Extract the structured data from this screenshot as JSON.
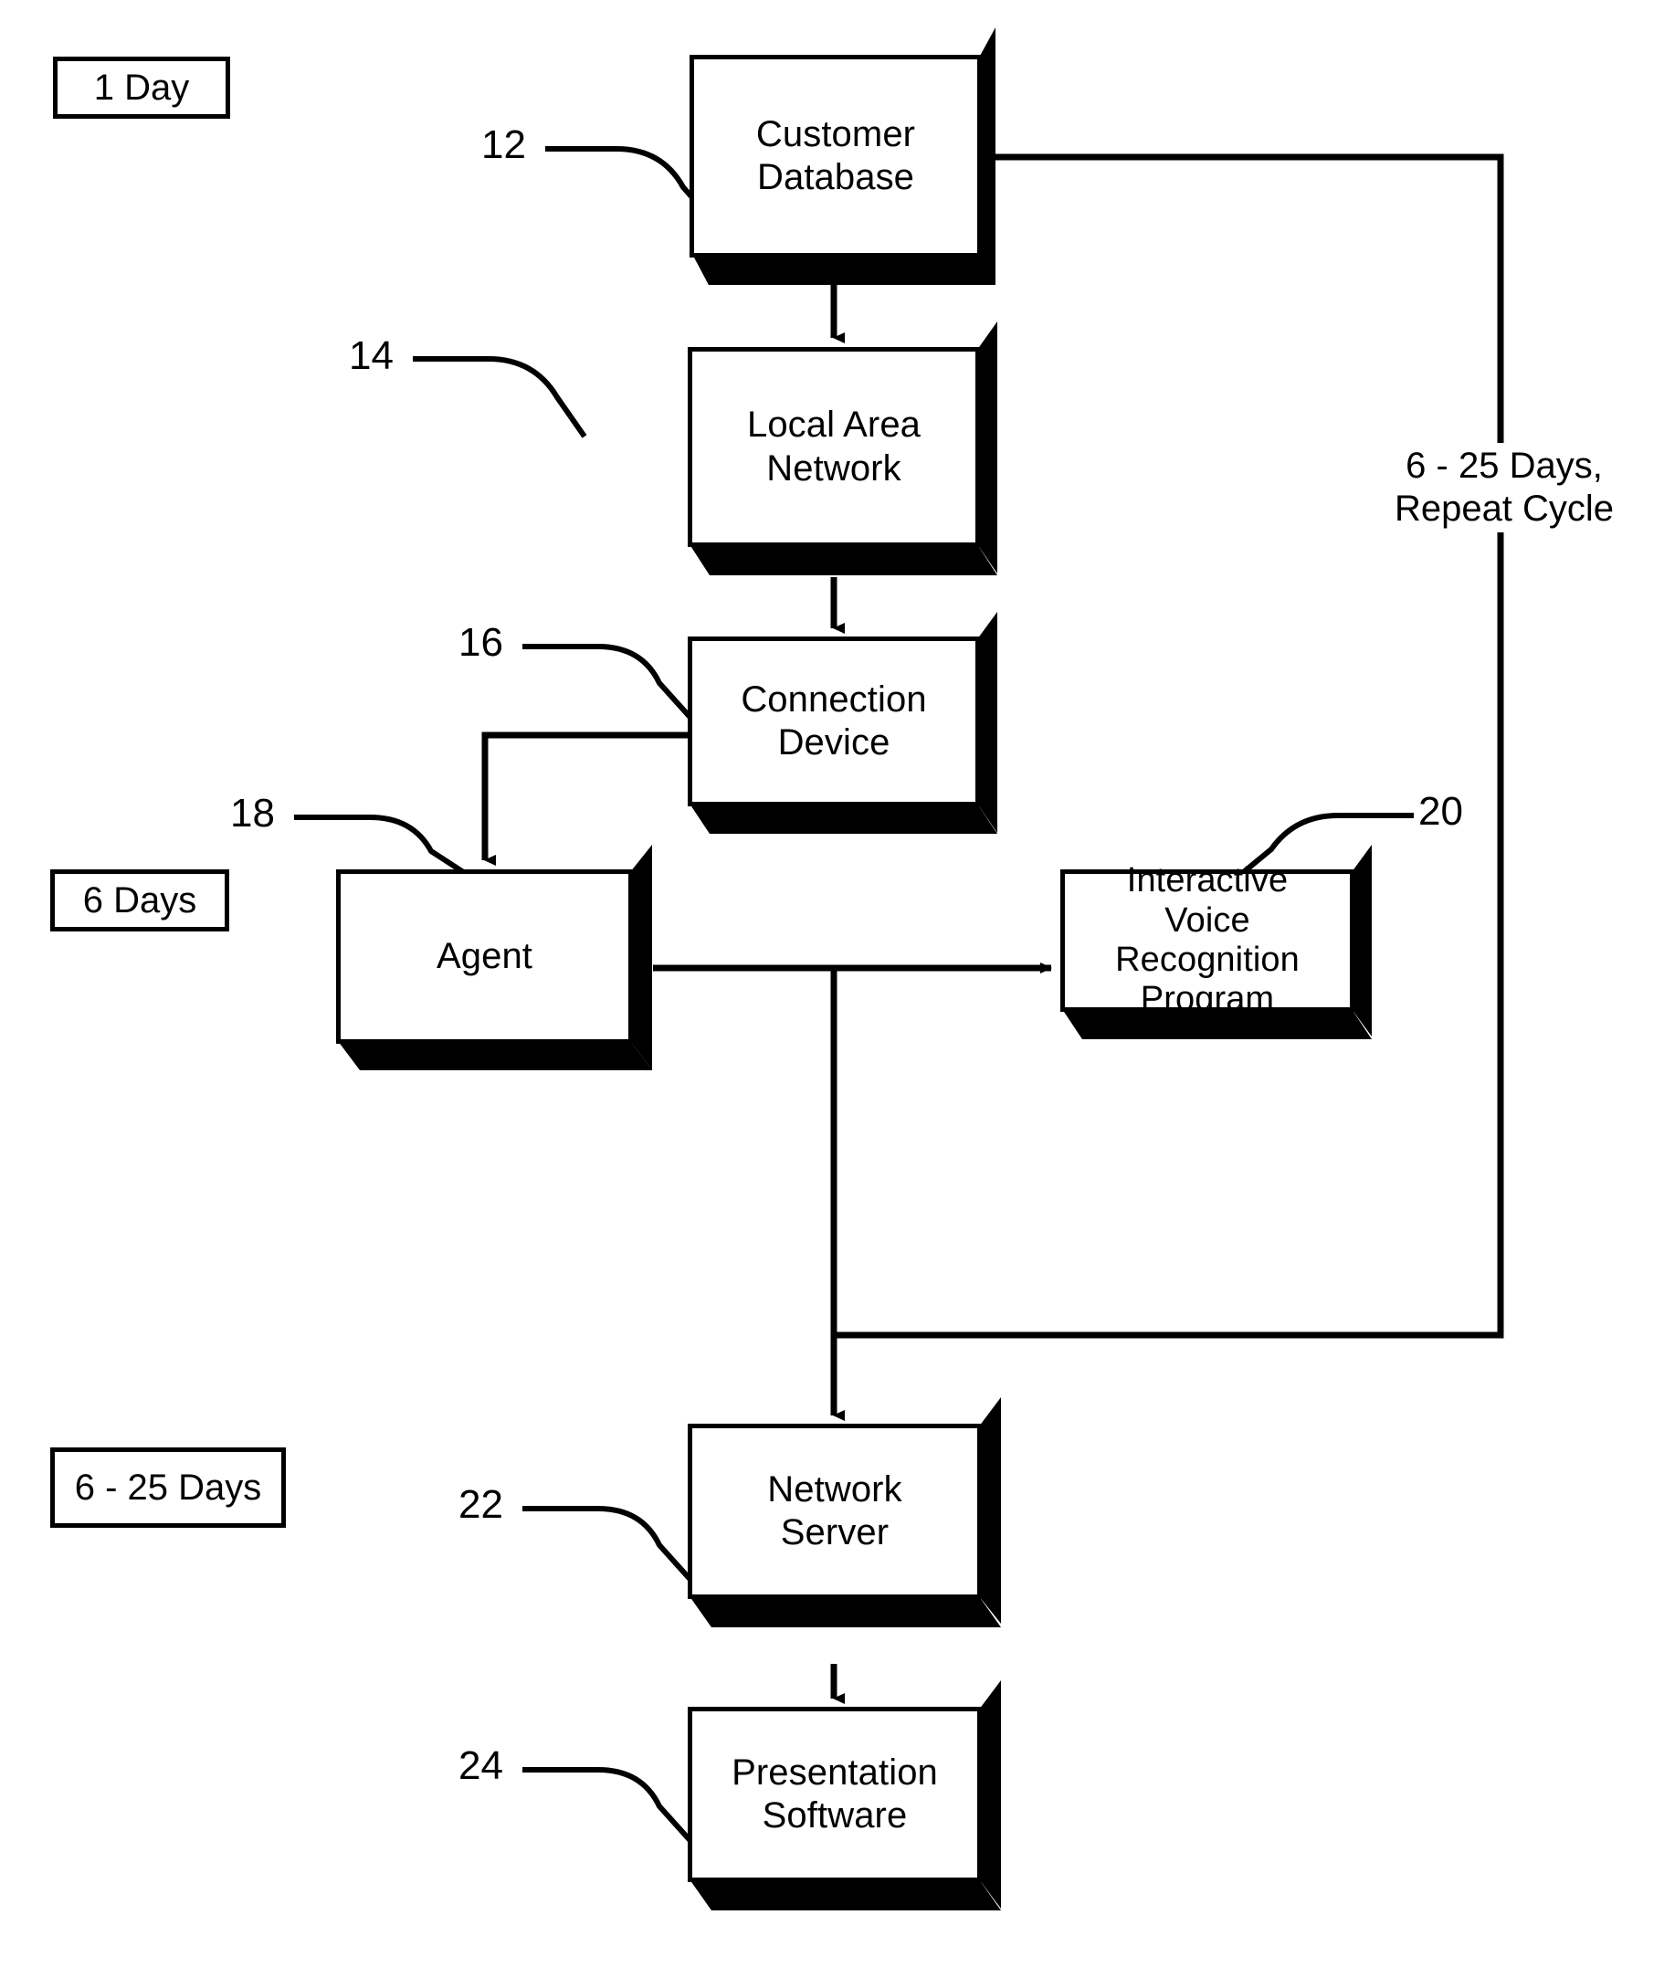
{
  "diagram": {
    "type": "patent-flowchart",
    "figure_style": "3D shadowed block diagram",
    "stroke_color": "#000000",
    "fill_color": "#ffffff",
    "phase_labels": [
      {
        "id": "phase-1-day",
        "text": "1 Day"
      },
      {
        "id": "phase-6-days",
        "text": "6 Days"
      },
      {
        "id": "phase-6-25-days",
        "text": "6 - 25 Days"
      }
    ],
    "nodes": [
      {
        "id": "customer-database",
        "ref": "12",
        "label": "Customer\nDatabase"
      },
      {
        "id": "local-area-network",
        "ref": "14",
        "label": "Local Area\nNetwork"
      },
      {
        "id": "connection-device",
        "ref": "16",
        "label": "Connection\nDevice"
      },
      {
        "id": "agent",
        "ref": "18",
        "label": "Agent"
      },
      {
        "id": "ivr-program",
        "ref": "20",
        "label": "Interactive\nVoice\nRecognition\nProgram"
      },
      {
        "id": "network-server",
        "ref": "22",
        "label": "Network\nServer"
      },
      {
        "id": "presentation-software",
        "ref": "24",
        "label": "Presentation\nSoftware"
      }
    ],
    "annotations": [
      {
        "id": "repeat-cycle-note",
        "text": "6 - 25 Days,\nRepeat Cycle"
      }
    ],
    "connections": [
      {
        "from": "customer-database",
        "to": "local-area-network",
        "kind": "arrow-down"
      },
      {
        "from": "local-area-network",
        "to": "connection-device",
        "kind": "arrow-down"
      },
      {
        "from": "connection-device",
        "to": "agent",
        "kind": "elbow-arrow-down"
      },
      {
        "from": "agent",
        "to": "ivr-program",
        "kind": "arrow-right"
      },
      {
        "from": "agent",
        "to": "network-server",
        "kind": "arrow-down"
      },
      {
        "from": "network-server",
        "to": "presentation-software",
        "kind": "arrow-down"
      },
      {
        "from": "customer-database",
        "to": "agent-branch",
        "kind": "return-loop",
        "note": "6 - 25 Days, Repeat Cycle"
      }
    ]
  }
}
